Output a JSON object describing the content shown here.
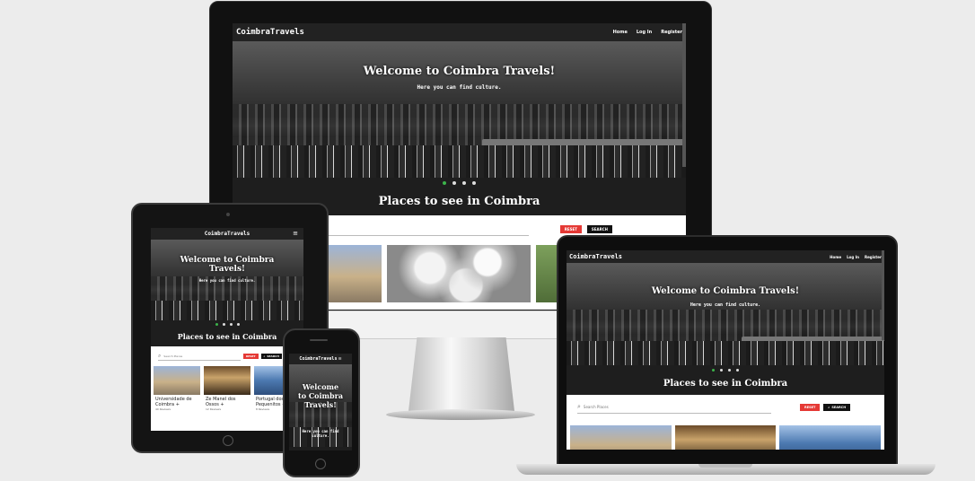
{
  "site": {
    "brand": "CoimbraTravels",
    "nav": {
      "home": "Home",
      "login": "Log In",
      "register": "Register"
    },
    "hero": {
      "title": "Welcome to Coimbra Travels!",
      "subtitle": "Here you can find culture."
    },
    "carousel_dots": 4,
    "section_title": "Places to see in Coimbra",
    "search": {
      "placeholder": "Search Places",
      "reset_label": "RESET",
      "search_label": "SEARCH"
    },
    "places": [
      {
        "name": "Universidade de Coimbra +",
        "meta": "40 Reviews"
      },
      {
        "name": "Ze Manel dos Ossos +",
        "meta": "12 Reviews"
      },
      {
        "name": "Portugal dos Pequenitos +",
        "meta": "8 Reviews"
      }
    ]
  },
  "colors": {
    "nav_bg": "#222222",
    "accent_green": "#3cb44b",
    "reset_red": "#e53935",
    "search_black": "#111111"
  }
}
